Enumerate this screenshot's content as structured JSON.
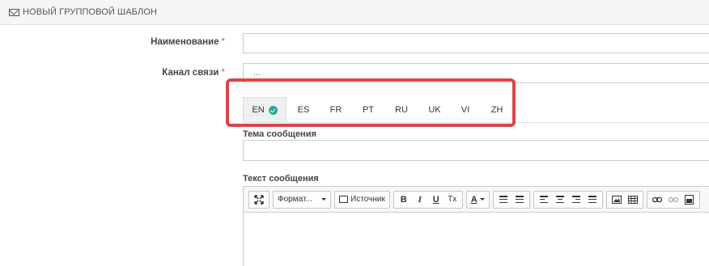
{
  "header": {
    "title": "НОВЫЙ ГРУППОВОЙ ШАБЛОН"
  },
  "form": {
    "name_label": "Наименование",
    "name_value": "",
    "channel_label": "Канал связи",
    "channel_value": "...",
    "required_mark": "*"
  },
  "languages": [
    {
      "code": "EN",
      "active": true
    },
    {
      "code": "ES"
    },
    {
      "code": "FR"
    },
    {
      "code": "PT"
    },
    {
      "code": "RU"
    },
    {
      "code": "UK"
    },
    {
      "code": "VI"
    },
    {
      "code": "ZH"
    }
  ],
  "subject": {
    "label": "Тема сообщения",
    "value": ""
  },
  "body": {
    "label": "Текст сообщения",
    "toolbar": {
      "format_label": "Формат...",
      "source_label": "Источник",
      "bold": "B",
      "italic": "I",
      "underline": "U",
      "clear_format": "Tx",
      "font_color": "A"
    }
  },
  "colors": {
    "highlight": "#d94549",
    "check": "#26a69a",
    "required": "#d9534f"
  }
}
